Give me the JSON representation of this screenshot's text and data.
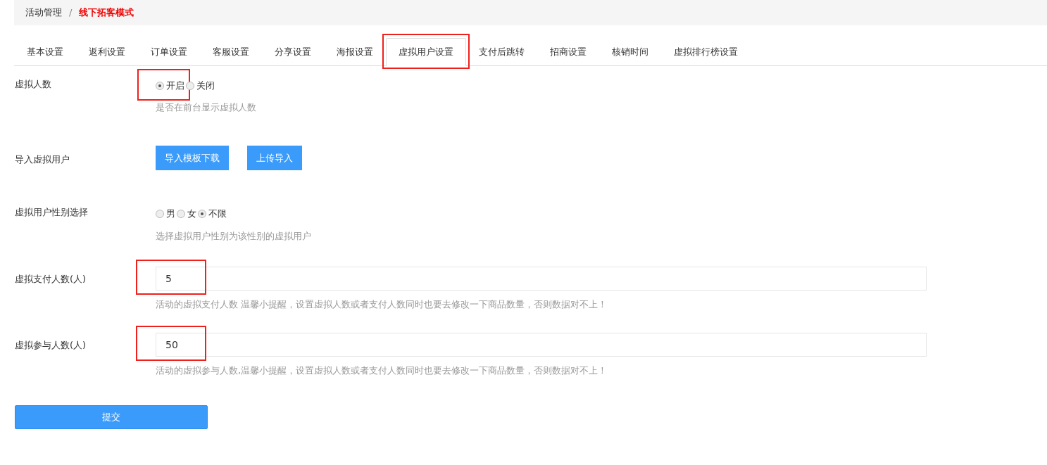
{
  "breadcrumb": [
    {
      "label": "活动管理",
      "current": false
    },
    {
      "label": "线下拓客模式",
      "current": true
    }
  ],
  "breadcrumb_separator": "/",
  "tabs": [
    {
      "label": "基本设置",
      "selected": false,
      "highlighted": false
    },
    {
      "label": "返利设置",
      "selected": false,
      "highlighted": false
    },
    {
      "label": "订单设置",
      "selected": false,
      "highlighted": false
    },
    {
      "label": "客服设置",
      "selected": false,
      "highlighted": false
    },
    {
      "label": "分享设置",
      "selected": false,
      "highlighted": false
    },
    {
      "label": "海报设置",
      "selected": false,
      "highlighted": false
    },
    {
      "label": "虚拟用户设置",
      "selected": true,
      "highlighted": true
    },
    {
      "label": "支付后跳转",
      "selected": false,
      "highlighted": false
    },
    {
      "label": "招商设置",
      "selected": false,
      "highlighted": false
    },
    {
      "label": "核销时间",
      "selected": false,
      "highlighted": false
    },
    {
      "label": "虚拟排行榜设置",
      "selected": false,
      "highlighted": false
    }
  ],
  "fields": [
    {
      "kind": "radio",
      "label": "虚拟人数",
      "options": [
        {
          "label": "开启",
          "selected": true,
          "highlighted": true
        },
        {
          "label": "关闭",
          "selected": false,
          "highlighted": false
        }
      ],
      "help": "是否在前台显示虚拟人数"
    },
    {
      "kind": "buttons",
      "label": "导入虚拟用户",
      "buttons": [
        "导入模板下载",
        "上传导入"
      ]
    },
    {
      "kind": "radio",
      "label": "虚拟用户性别选择",
      "options": [
        {
          "label": "男",
          "selected": false,
          "highlighted": false
        },
        {
          "label": "女",
          "selected": false,
          "highlighted": false
        },
        {
          "label": "不限",
          "selected": true,
          "highlighted": false
        }
      ],
      "help": "选择虚拟用户性别为该性别的虚拟用户"
    },
    {
      "kind": "input",
      "label": "虚拟支付人数(人)",
      "value": "5",
      "highlighted": true,
      "help": "活动的虚拟支付人数 温馨小提醒，设置虚拟人数或者支付人数同时也要去修改一下商品数量，否则数据对不上！"
    },
    {
      "kind": "input",
      "label": "虚拟参与人数(人)",
      "value": "50",
      "highlighted": true,
      "help": "活动的虚拟参与人数,温馨小提醒，设置虚拟人数或者支付人数同时也要去修改一下商品数量，否则数据对不上！"
    }
  ],
  "submit": "提交"
}
